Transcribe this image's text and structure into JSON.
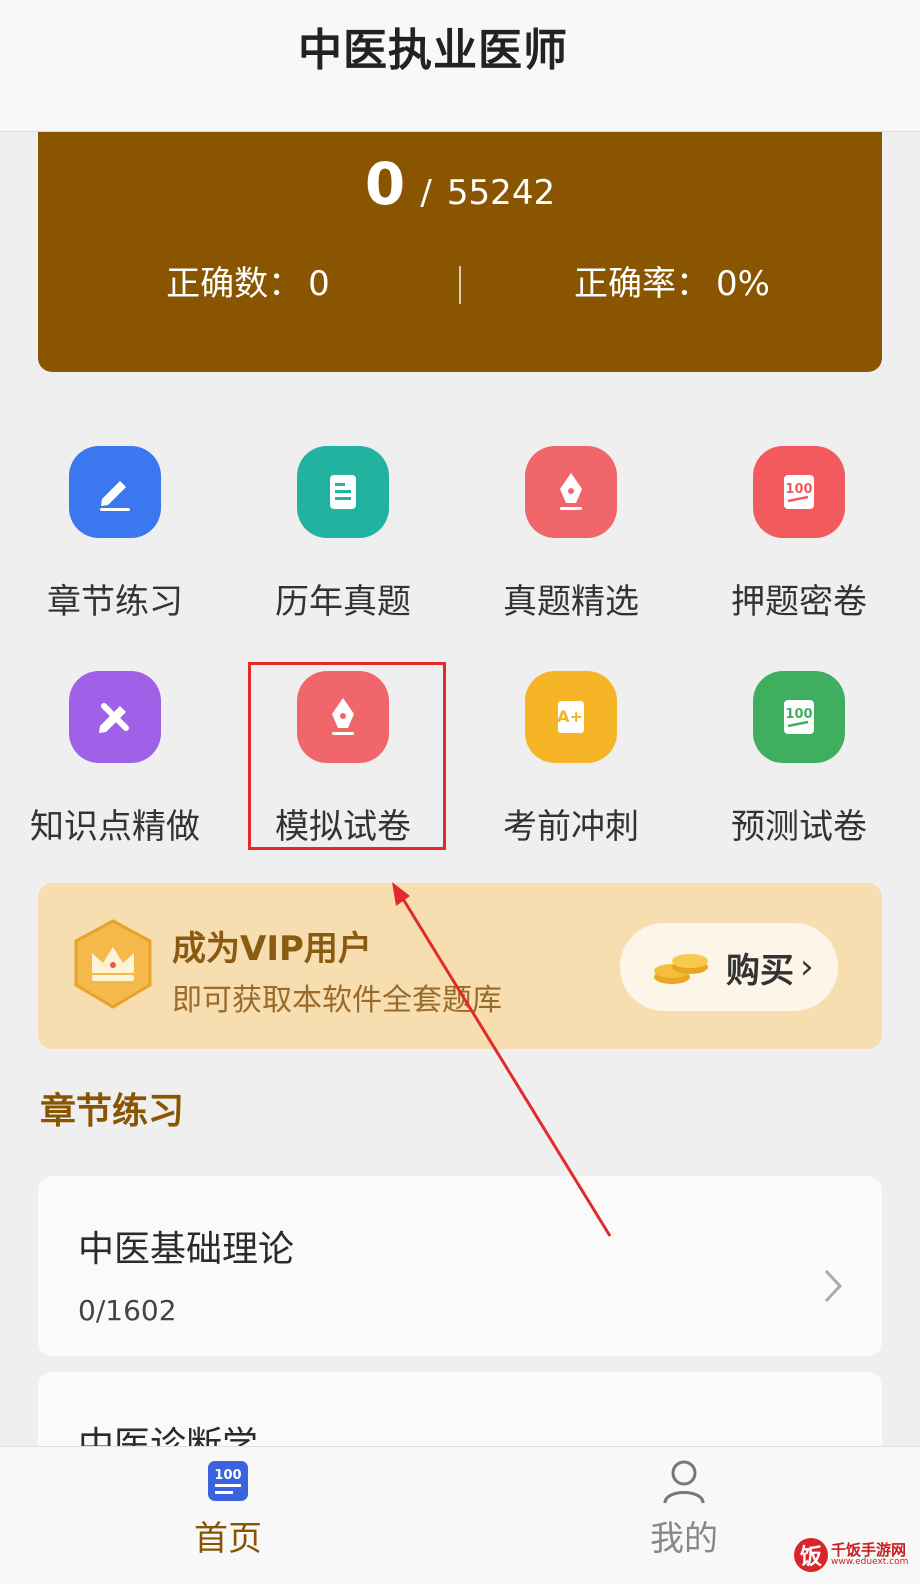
{
  "header": {
    "title": "中医执业医师"
  },
  "stats": {
    "done": "0",
    "separator": "/",
    "total": "55242",
    "correct_label": "正确数：",
    "correct_value": "0",
    "rate_label": "正确率：",
    "rate_value": "0%"
  },
  "grid": [
    {
      "label": "章节练习",
      "icon": "pencil-edit-icon",
      "color": "#3b78f0"
    },
    {
      "label": "历年真题",
      "icon": "document-icon",
      "color": "#22b3a0"
    },
    {
      "label": "真题精选",
      "icon": "fountain-pen-icon",
      "color": "#f0666a"
    },
    {
      "label": "押题密卷",
      "icon": "score-100-paper-icon",
      "color": "#f25a5e"
    },
    {
      "label": "知识点精做",
      "icon": "pencil-ruler-icon",
      "color": "#a060e8"
    },
    {
      "label": "模拟试卷",
      "icon": "fountain-pen-icon",
      "color": "#f0666a"
    },
    {
      "label": "考前冲刺",
      "icon": "grade-a-plus-scroll-icon",
      "color": "#f5b526"
    },
    {
      "label": "预测试卷",
      "icon": "score-100-paper-icon",
      "color": "#3fae5e"
    }
  ],
  "vip": {
    "title": "成为VIP用户",
    "subtitle": "即可获取本软件全套题库",
    "buy_label": "购买",
    "buy_chevron": "›"
  },
  "section": {
    "title": "章节练习"
  },
  "chapters": [
    {
      "name": "中医基础理论",
      "progress": "0/1602"
    },
    {
      "name": "中医诊断学",
      "progress": ""
    }
  ],
  "tabs": [
    {
      "label": "首页",
      "icon": "score-100-tab-icon",
      "color": "#8a5500"
    },
    {
      "label": "我的",
      "icon": "user-profile-icon",
      "color": "#888888"
    }
  ],
  "watermark": {
    "logo": "饭",
    "name": "千饭手游网",
    "url": "www.eduext.com"
  },
  "colors": {
    "brand": "#8a5500",
    "vip_bg": "#f7deb0",
    "highlight": "#e32a2a"
  }
}
